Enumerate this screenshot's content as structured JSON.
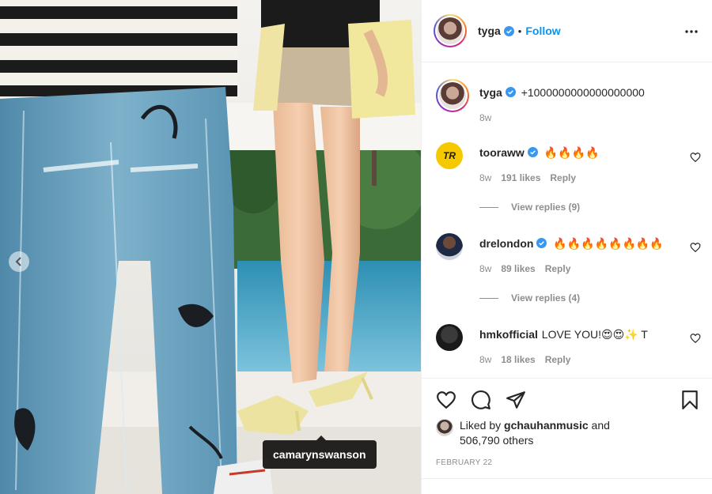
{
  "post": {
    "author": "tyga",
    "separator": "•",
    "follow_label": "Follow",
    "caption": "+1000000000000000000",
    "caption_age": "8w",
    "photo_tag": "camarynswanson"
  },
  "comments": [
    {
      "user": "tooraww",
      "verified": true,
      "text": "🔥🔥🔥🔥",
      "age": "8w",
      "likes": "191 likes",
      "reply": "Reply",
      "view_replies": "View replies (9)"
    },
    {
      "user": "drelondon",
      "verified": true,
      "text": "🔥🔥🔥🔥🔥🔥🔥🔥",
      "age": "8w",
      "likes": "89 likes",
      "reply": "Reply",
      "view_replies": "View replies (4)"
    },
    {
      "user": "hmkofficial",
      "verified": false,
      "text": "LOVE YOU!😍😍✨ T",
      "age": "8w",
      "likes": "18 likes",
      "reply": "Reply"
    }
  ],
  "engagement": {
    "liked_prefix": "Liked by",
    "liked_user": "gchauhanmusic",
    "liked_and": "and",
    "others": "506,790 others",
    "date": "FEBRUARY 22"
  },
  "colors": {
    "accent": "#0095f6",
    "verified": "#3897f0",
    "muted": "#8e8e8e"
  },
  "icons": [
    "more-options-icon",
    "heart-icon",
    "comment-icon",
    "share-icon",
    "bookmark-icon",
    "chevron-left-icon",
    "verified-icon"
  ]
}
